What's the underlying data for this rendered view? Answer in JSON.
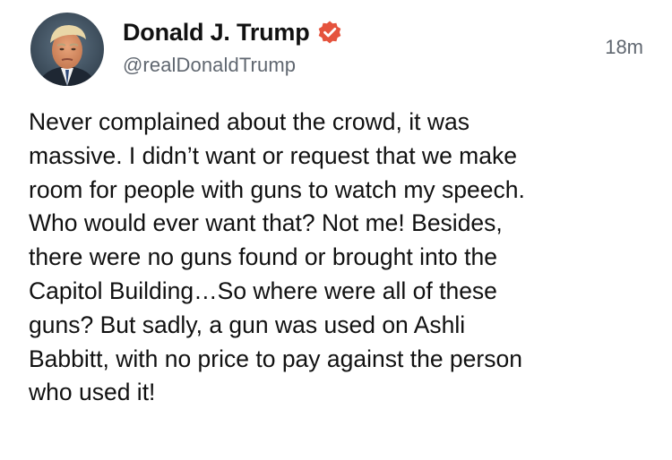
{
  "author": {
    "display_name": "Donald J. Trump",
    "handle": "@realDonaldTrump",
    "verified": true,
    "verified_color": "#E5533D"
  },
  "post": {
    "timestamp": "18m",
    "text": "Never complained about the crowd, it was\nmassive. I didn’t want or request that we make\nroom for people with guns to watch my speech.\nWho would ever want that? Not me! Besides,\nthere were no guns found or brought into the\nCapitol Building…So where were all of these\nguns? But sadly, a gun was used on Ashli\nBabbitt, with no price to pay against the person\nwho used it!"
  }
}
